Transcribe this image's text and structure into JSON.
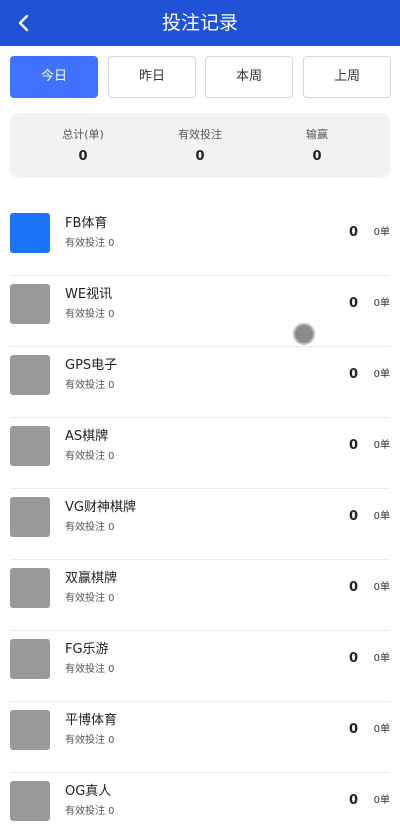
{
  "header": {
    "title": "投注记录",
    "back_icon": "chevron-left-icon"
  },
  "tabs": [
    {
      "label": "今日",
      "active": true
    },
    {
      "label": "昨日",
      "active": false
    },
    {
      "label": "本周",
      "active": false
    },
    {
      "label": "上周",
      "active": false
    }
  ],
  "summary": [
    {
      "label": "总计(单)",
      "value": "0"
    },
    {
      "label": "有效投注",
      "value": "0"
    },
    {
      "label": "输赢",
      "value": "0"
    }
  ],
  "records": [
    {
      "name": "FB体育",
      "sub": "有效投注 0",
      "amount": "0",
      "orders": "0单",
      "thumb_color": "#1b74f5"
    },
    {
      "name": "WE视讯",
      "sub": "有效投注 0",
      "amount": "0",
      "orders": "0单",
      "thumb_color": "#999999"
    },
    {
      "name": "GPS电子",
      "sub": "有效投注 0",
      "amount": "0",
      "orders": "0单",
      "thumb_color": "#999999"
    },
    {
      "name": "AS棋牌",
      "sub": "有效投注 0",
      "amount": "0",
      "orders": "0单",
      "thumb_color": "#999999"
    },
    {
      "name": "VG财神棋牌",
      "sub": "有效投注 0",
      "amount": "0",
      "orders": "0单",
      "thumb_color": "#999999"
    },
    {
      "name": "双赢棋牌",
      "sub": "有效投注 0",
      "amount": "0",
      "orders": "0单",
      "thumb_color": "#999999"
    },
    {
      "name": "FG乐游",
      "sub": "有效投注 0",
      "amount": "0",
      "orders": "0单",
      "thumb_color": "#999999"
    },
    {
      "name": "平博体育",
      "sub": "有效投注 0",
      "amount": "0",
      "orders": "0单",
      "thumb_color": "#999999"
    },
    {
      "name": "OG真人",
      "sub": "有效投注 0",
      "amount": "0",
      "orders": "0单",
      "thumb_color": "#999999"
    }
  ],
  "colors": {
    "header_bg": "#1f52d6",
    "tab_active": "#3e72ff"
  }
}
